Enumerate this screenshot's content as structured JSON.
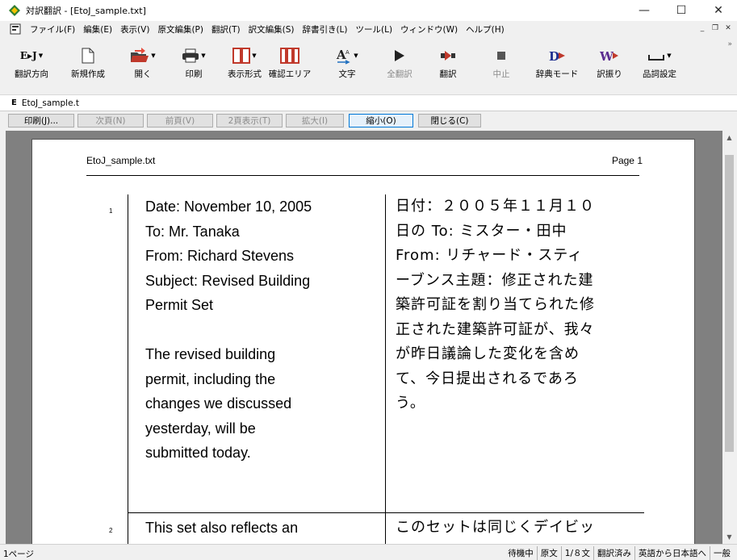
{
  "window": {
    "title": "対訳翻訳 - [EtoJ_sample.txt]",
    "minimize": "—",
    "maximize": "☐",
    "close": "✕"
  },
  "menu": {
    "items": [
      "ファイル(F)",
      "編集(E)",
      "表示(V)",
      "原文編集(P)",
      "翻訳(T)",
      "訳文編集(S)",
      "辞書引き(L)",
      "ツール(L)",
      "ウィンドウ(W)",
      "ヘルプ(H)"
    ],
    "mdi_minimize": "_",
    "mdi_restore": "❐",
    "mdi_close": "✕"
  },
  "toolbar": {
    "direction_label": "翻訳方向",
    "direction_icon_text": "E▸J",
    "new_label": "新規作成",
    "open_label": "開く",
    "print_label": "印刷",
    "display_label": "表示形式",
    "confirm_label": "確認エリア",
    "char_label": "文字",
    "translate_all_label": "全翻訳",
    "translate_label": "翻訳",
    "stop_label": "中止",
    "dictmode_label": "辞典モード",
    "furigana_label": "訳振り",
    "pos_label": "品詞設定",
    "overflow": "»"
  },
  "tab": {
    "icon": "E",
    "label": "EtoJ_sample.t"
  },
  "preview_buttons": {
    "print": "印刷(J)...",
    "next": "次頁(N)",
    "prev": "前頁(V)",
    "two_page": "2頁表示(T)",
    "zoom_in": "拡大(I)",
    "zoom_out": "縮小(O)",
    "close": "閉じる(C)"
  },
  "page": {
    "filename": "EtoJ_sample.txt",
    "page_number": "Page 1",
    "rows": [
      {
        "num": "1",
        "en": "Date: November 10, 2005\nTo: Mr. Tanaka\nFrom: Richard Stevens\nSubject: Revised Building\nPermit Set\n\nThe revised building\npermit, including the\nchanges we discussed\nyesterday, will be\nsubmitted today.",
        "jp": "日付：２００５年１１月１０\n日の To: ミスター・田中\nFrom: リチャード・スティ\nーブンス主題：修正された建\n築許可証を割り当てられた修\n正された建築許可証が、我々\nが昨日議論した変化を含め\nて、今日提出されるであろ\nう。"
      },
      {
        "num": "2",
        "en": "This set also reflects an",
        "jp": "このセットは同じくデイビッ"
      }
    ]
  },
  "status": {
    "pages": "1ページ",
    "state": "待機中",
    "mode": "原文",
    "position": "1/８文",
    "translated": "翻訳済み",
    "direction": "英語から日本語へ",
    "field": "一般"
  }
}
